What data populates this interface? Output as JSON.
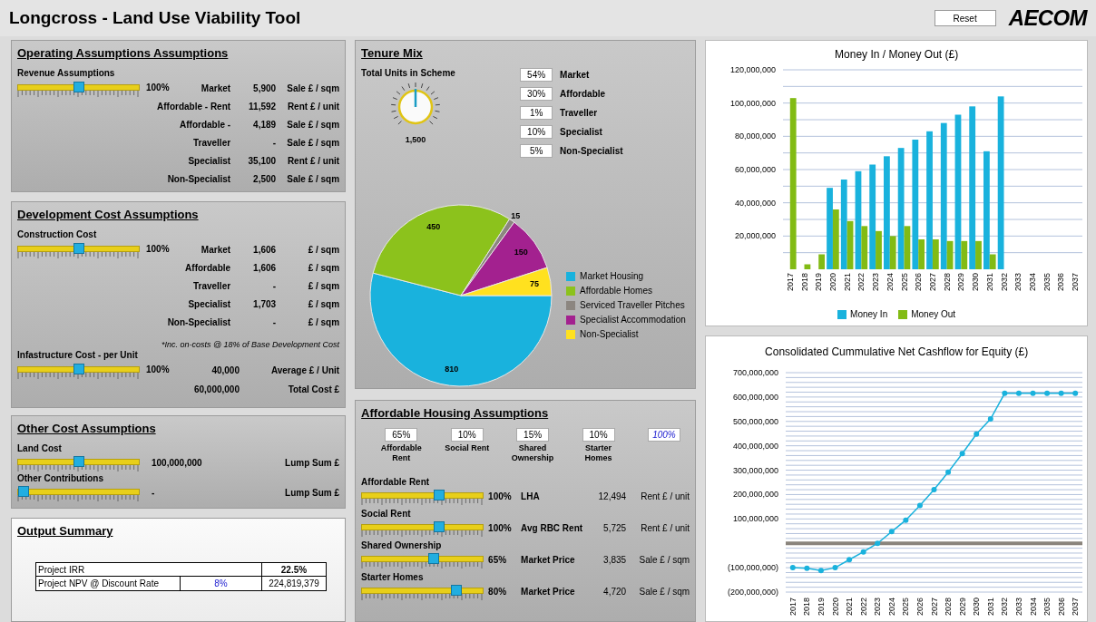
{
  "header": {
    "title": "Longcross - Land Use Viability Tool",
    "reset_button": "Reset",
    "logo": "AECOM"
  },
  "operating_assumptions": {
    "title": "Operating Assumptions Assumptions",
    "slider_label": "Revenue Assumptions",
    "slider": {
      "level": 0.5,
      "reading": "100%"
    },
    "rows": [
      {
        "label": "Market",
        "value": "5,900",
        "unit": "Sale £ / sqm"
      },
      {
        "label": "Affordable - Rent",
        "value": "11,592",
        "unit": "Rent £ / unit"
      },
      {
        "label": "Affordable -",
        "value": "4,189",
        "unit": "Sale £ / sqm"
      },
      {
        "label": "Traveller",
        "value": "-",
        "unit": "Sale £ / sqm"
      },
      {
        "label": "Specialist",
        "value": "35,100",
        "unit": "Rent £ / unit"
      },
      {
        "label": "Non-Specialist",
        "value": "2,500",
        "unit": "Sale £ / sqm"
      }
    ]
  },
  "development_cost": {
    "title": "Development Cost Assumptions",
    "slider_label": "Construction Cost",
    "slider": {
      "level": 0.5,
      "reading": "100%"
    },
    "rows": [
      {
        "label": "Market",
        "value": "1,606",
        "unit": "£ / sqm"
      },
      {
        "label": "Affordable",
        "value": "1,606",
        "unit": "£ / sqm"
      },
      {
        "label": "Traveller",
        "value": "-",
        "unit": "£ / sqm"
      },
      {
        "label": "Specialist",
        "value": "1,703",
        "unit": "£ / sqm"
      },
      {
        "label": "Non-Specialist",
        "value": "-",
        "unit": "£ / sqm"
      }
    ],
    "note": "*Inc. on-costs @ 18% of Base Development Cost",
    "infrastructure": {
      "label": "Infastructure Cost - per Unit",
      "level": 0.5,
      "reading": "100%",
      "value": "40,000",
      "unit": "Average £ / Unit",
      "total_value": "60,000,000",
      "total_unit": "Total Cost £"
    }
  },
  "other_cost": {
    "title": "Other Cost Assumptions",
    "items": [
      {
        "label": "Land Cost",
        "level": 0.5,
        "value": "100,000,000",
        "unit": "Lump Sum £"
      },
      {
        "label": "Other Contributions",
        "level": 0,
        "value": "-",
        "unit": "Lump Sum £"
      }
    ]
  },
  "output_summary": {
    "title": "Output Summary",
    "irr": {
      "label": "Project IRR",
      "value": "22.5%"
    },
    "npv": {
      "label": "Project NPV @ Discount Rate",
      "rate": "8%",
      "value": "224,819,379"
    }
  },
  "tenure_mix": {
    "title": "Tenure Mix",
    "dial": {
      "label": "Total Units in Scheme",
      "value": "1,500"
    },
    "shares": [
      {
        "value": "54%",
        "label": "Market"
      },
      {
        "value": "30%",
        "label": "Affordable"
      },
      {
        "value": "1%",
        "label": "Traveller"
      },
      {
        "value": "10%",
        "label": "Specialist"
      },
      {
        "value": "5%",
        "label": "Non-Specialist"
      }
    ],
    "chart_data": {
      "type": "pie",
      "categories": [
        "Market Housing",
        "Affordable Homes",
        "Serviced Traveller Pitches",
        "Specialist Accommodation",
        "Non-Specialist"
      ],
      "values": [
        810,
        450,
        15,
        150,
        75
      ],
      "colors": [
        "#19b2dd",
        "#8cc21c",
        "#8c8680",
        "#a3218f",
        "#ffe11f"
      ],
      "data_labels": true,
      "legend": true
    }
  },
  "affordable_housing": {
    "title": "Affordable Housing Assumptions",
    "shares": [
      {
        "value": "65%",
        "label": "Affordable Rent"
      },
      {
        "value": "10%",
        "label": "Social Rent"
      },
      {
        "value": "15%",
        "label": "Shared Ownership"
      },
      {
        "value": "10%",
        "label": "Starter Homes"
      }
    ],
    "total": "100%",
    "sliders": [
      {
        "label": "Affordable Rent",
        "level": 0.65,
        "reading": "100%",
        "basis": "LHA",
        "value": "12,494",
        "unit": "Rent £ / unit"
      },
      {
        "label": "Social Rent",
        "level": 0.65,
        "reading": "100%",
        "basis": "Avg RBC Rent",
        "value": "5,725",
        "unit": "Rent £ / unit"
      },
      {
        "label": "Shared Ownership",
        "level": 0.6,
        "reading": "65%",
        "basis": "Market Price",
        "value": "3,835",
        "unit": "Sale £ / sqm"
      },
      {
        "label": "Starter Homes",
        "level": 0.8,
        "reading": "80%",
        "basis": "Market Price",
        "value": "4,720",
        "unit": "Sale £ / sqm"
      }
    ]
  },
  "money_chart": {
    "chart_data": {
      "type": "bar",
      "title": "Money In / Money Out (£)",
      "categories": [
        "2017",
        "2018",
        "2019",
        "2020",
        "2021",
        "2022",
        "2023",
        "2024",
        "2025",
        "2026",
        "2027",
        "2028",
        "2029",
        "2030",
        "2031",
        "2032",
        "2033",
        "2034",
        "2035",
        "2036",
        "2037"
      ],
      "series": [
        {
          "name": "Money In",
          "color": "#19b2dd",
          "values": [
            null,
            null,
            null,
            49000000,
            54000000,
            59000000,
            63000000,
            68000000,
            73000000,
            78000000,
            83000000,
            88000000,
            93000000,
            98000000,
            71000000,
            104000000,
            null,
            null,
            null,
            null,
            null
          ]
        },
        {
          "name": "Money Out",
          "color": "#82bb14",
          "values": [
            103000000,
            3000000,
            9000000,
            36000000,
            29000000,
            26000000,
            23000000,
            20000000,
            26000000,
            18000000,
            18000000,
            17000000,
            17000000,
            17000000,
            9000000,
            null,
            null,
            null,
            null,
            null,
            null
          ]
        }
      ],
      "ylim": [
        0,
        120000000
      ],
      "grid": true,
      "legend": true,
      "yticks": [
        {
          "value": 20000000,
          "label": "20,000,000"
        },
        {
          "value": 40000000,
          "label": "40,000,000"
        },
        {
          "value": 60000000,
          "label": "60,000,000"
        },
        {
          "value": 80000000,
          "label": "80,000,000"
        },
        {
          "value": 100000000,
          "label": "100,000,000"
        },
        {
          "value": 120000000,
          "label": "120,000,000"
        }
      ]
    }
  },
  "cashflow_chart": {
    "chart_data": {
      "type": "line",
      "title": "Consolidated Cummulative Net Cashflow for Equity (£)",
      "categories": [
        "2017",
        "2018",
        "2019",
        "2020",
        "2021",
        "2022",
        "2023",
        "2024",
        "2025",
        "2026",
        "2027",
        "2028",
        "2029",
        "2030",
        "2031",
        "2032",
        "2033",
        "2034",
        "2035",
        "2036",
        "2037"
      ],
      "grid": true,
      "series": [
        {
          "color": "#19b2dd",
          "marker": "circle",
          "values": [
            -100000000,
            -102000000,
            -112000000,
            -100000000,
            -67000000,
            -35000000,
            0,
            48000000,
            95000000,
            155000000,
            220000000,
            292000000,
            368000000,
            448000000,
            510000000,
            615000000,
            615000000,
            615000000,
            615000000,
            615000000,
            615000000
          ]
        }
      ],
      "ylim": [
        -200000000,
        700000000
      ],
      "yticks": [
        {
          "value": -200000000,
          "label": "(200,000,000)"
        },
        {
          "value": -100000000,
          "label": "(100,000,000)"
        },
        {
          "value": 100000000,
          "label": "100,000,000"
        },
        {
          "value": 200000000,
          "label": "200,000,000"
        },
        {
          "value": 300000000,
          "label": "300,000,000"
        },
        {
          "value": 400000000,
          "label": "400,000,000"
        },
        {
          "value": 500000000,
          "label": "500,000,000"
        },
        {
          "value": 600000000,
          "label": "600,000,000"
        },
        {
          "value": 700000000,
          "label": "700,000,000"
        }
      ]
    }
  }
}
